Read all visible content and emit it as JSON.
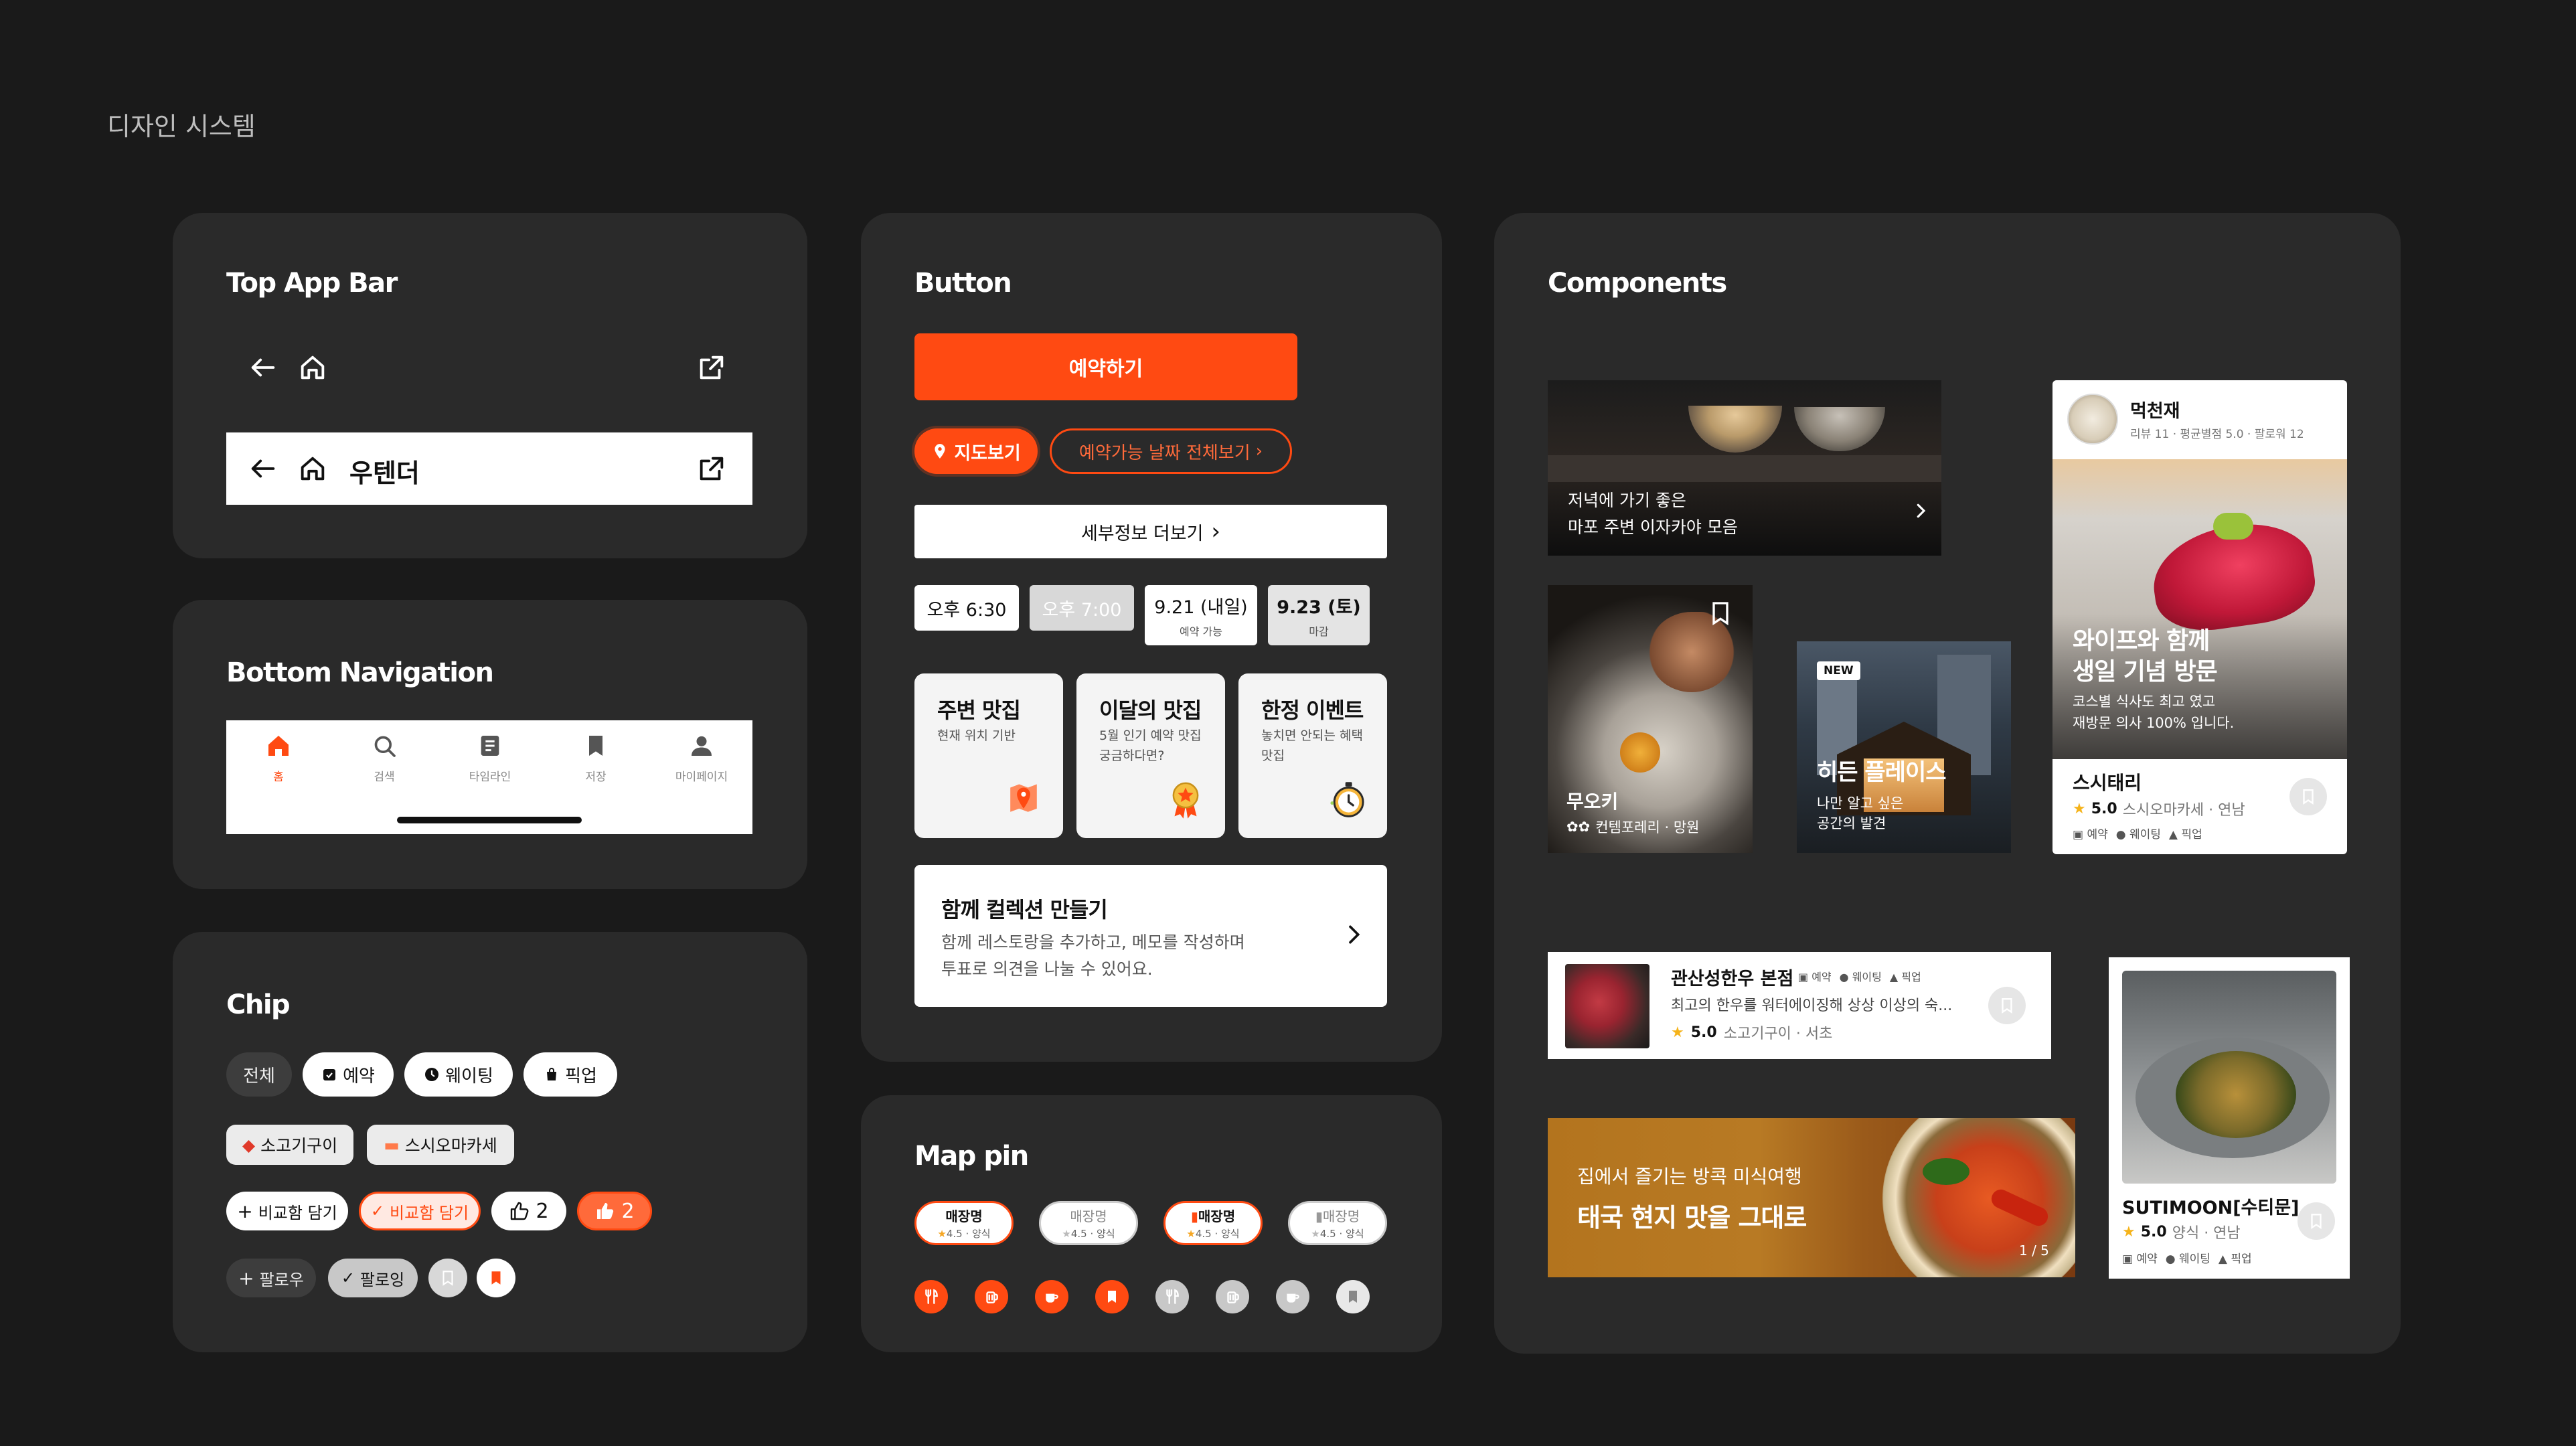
{
  "page": {
    "title": "디자인 시스템"
  },
  "top_app_bar": {
    "section_title": "Top App Bar",
    "title": "우텐더"
  },
  "bottom_nav": {
    "section_title": "Bottom Navigation",
    "items": [
      {
        "label": "홈",
        "icon": "home-icon",
        "active": true
      },
      {
        "label": "검색",
        "icon": "search-icon"
      },
      {
        "label": "타임라인",
        "icon": "timeline-icon"
      },
      {
        "label": "저장",
        "icon": "bookmark-icon"
      },
      {
        "label": "마이페이지",
        "icon": "person-icon"
      }
    ]
  },
  "chip": {
    "section_title": "Chip",
    "row1": [
      "전체",
      "예약",
      "웨이팅",
      "픽업"
    ],
    "row2": [
      "소고기구이",
      "스시오마카세"
    ],
    "row3": [
      "비교함 담기",
      "비교함 담기",
      "2",
      "2"
    ],
    "row4": [
      "팔로우",
      "팔로잉"
    ]
  },
  "button": {
    "section_title": "Button",
    "primary": "예약하기",
    "map_view": "지도보기",
    "all_dates": "예약가능 날짜 전체보기",
    "more_detail": "세부정보 더보기",
    "times": [
      {
        "time": "오후 6:30",
        "sub": "",
        "state": "normal"
      },
      {
        "time": "오후 7:00",
        "sub": "",
        "state": "disabled"
      },
      {
        "time": "9.21 (내일)",
        "sub": "예약 가능",
        "state": "normal"
      },
      {
        "time": "9.23 (토)",
        "sub": "마감",
        "state": "closed"
      }
    ],
    "cards": [
      {
        "title": "주변 맛집",
        "desc": "현재 위치 기반"
      },
      {
        "title": "이달의 맛집",
        "desc": "5월 인기 예약 맛집 궁금하다면?"
      },
      {
        "title": "한정 이벤트",
        "desc": "놓치면 안되는 혜택 맛집"
      }
    ],
    "collection": {
      "title": "함께 컬렉션 만들기",
      "desc1": "함께 레스토랑을 추가하고, 메모를 작성하며",
      "desc2": "투표로 의견을 나눌 수 있어요."
    }
  },
  "map_pin": {
    "section_title": "Map pin",
    "pins": [
      {
        "name": "매장명",
        "meta": "4.5 · 양식",
        "style": "orange"
      },
      {
        "name": "매장명",
        "meta": "4.5 · 양식",
        "style": "grey"
      },
      {
        "name": "매장명",
        "meta": "4.5 · 양식",
        "style": "orange-bookmark"
      },
      {
        "name": "매장명",
        "meta": "4.5 · 양식",
        "style": "grey-bookmark"
      }
    ]
  },
  "components": {
    "section_title": "Components",
    "banner1": {
      "line1": "저녁에 가기 좋은",
      "line2": "마포 주변 이자카야 모음"
    },
    "card_muoki": {
      "name": "무오키",
      "meta": "컨템포레리 · 망원"
    },
    "card_hidden": {
      "badge": "NEW",
      "title": "히든 플레이스",
      "line1": "나만 알고 싶은",
      "line2": "공간의 발견"
    },
    "review_card": {
      "user": "먹천재",
      "user_meta": "리뷰 11 · 평균별점 5.0 · 팔로워 12",
      "headline1": "와이프와 함께",
      "headline2": "생일 기념 방문",
      "body1": "코스별 식사도 최고 였고",
      "body2": "재방문 의사 100% 입니다.",
      "place": "스시태리",
      "rating": "5.0",
      "place_meta": "스시오마카세 · 연남",
      "tags": [
        "예약",
        "웨이팅",
        "픽업"
      ]
    },
    "list_item": {
      "name": "관산성한우 본점",
      "tags": [
        "예약",
        "웨이팅",
        "픽업"
      ],
      "desc": "최고의 한우를 워터에이징해 상상 이상의 숙...",
      "rating": "5.0",
      "meta": "소고기구이 · 서초"
    },
    "promo": {
      "line1": "집에서 즐기는 방콕 미식여행",
      "line2": "태국 현지 맛을 그대로",
      "pager": "1 / 5"
    },
    "vertical_card": {
      "name": "SUTIMOON[수티문]",
      "rating": "5.0",
      "meta": "양식 · 연남",
      "tags": [
        "예약",
        "웨이팅",
        "픽업"
      ]
    }
  },
  "colors": {
    "accent": "#ff4a12",
    "panel": "#2a2a2a",
    "bg": "#1a1a1a"
  }
}
